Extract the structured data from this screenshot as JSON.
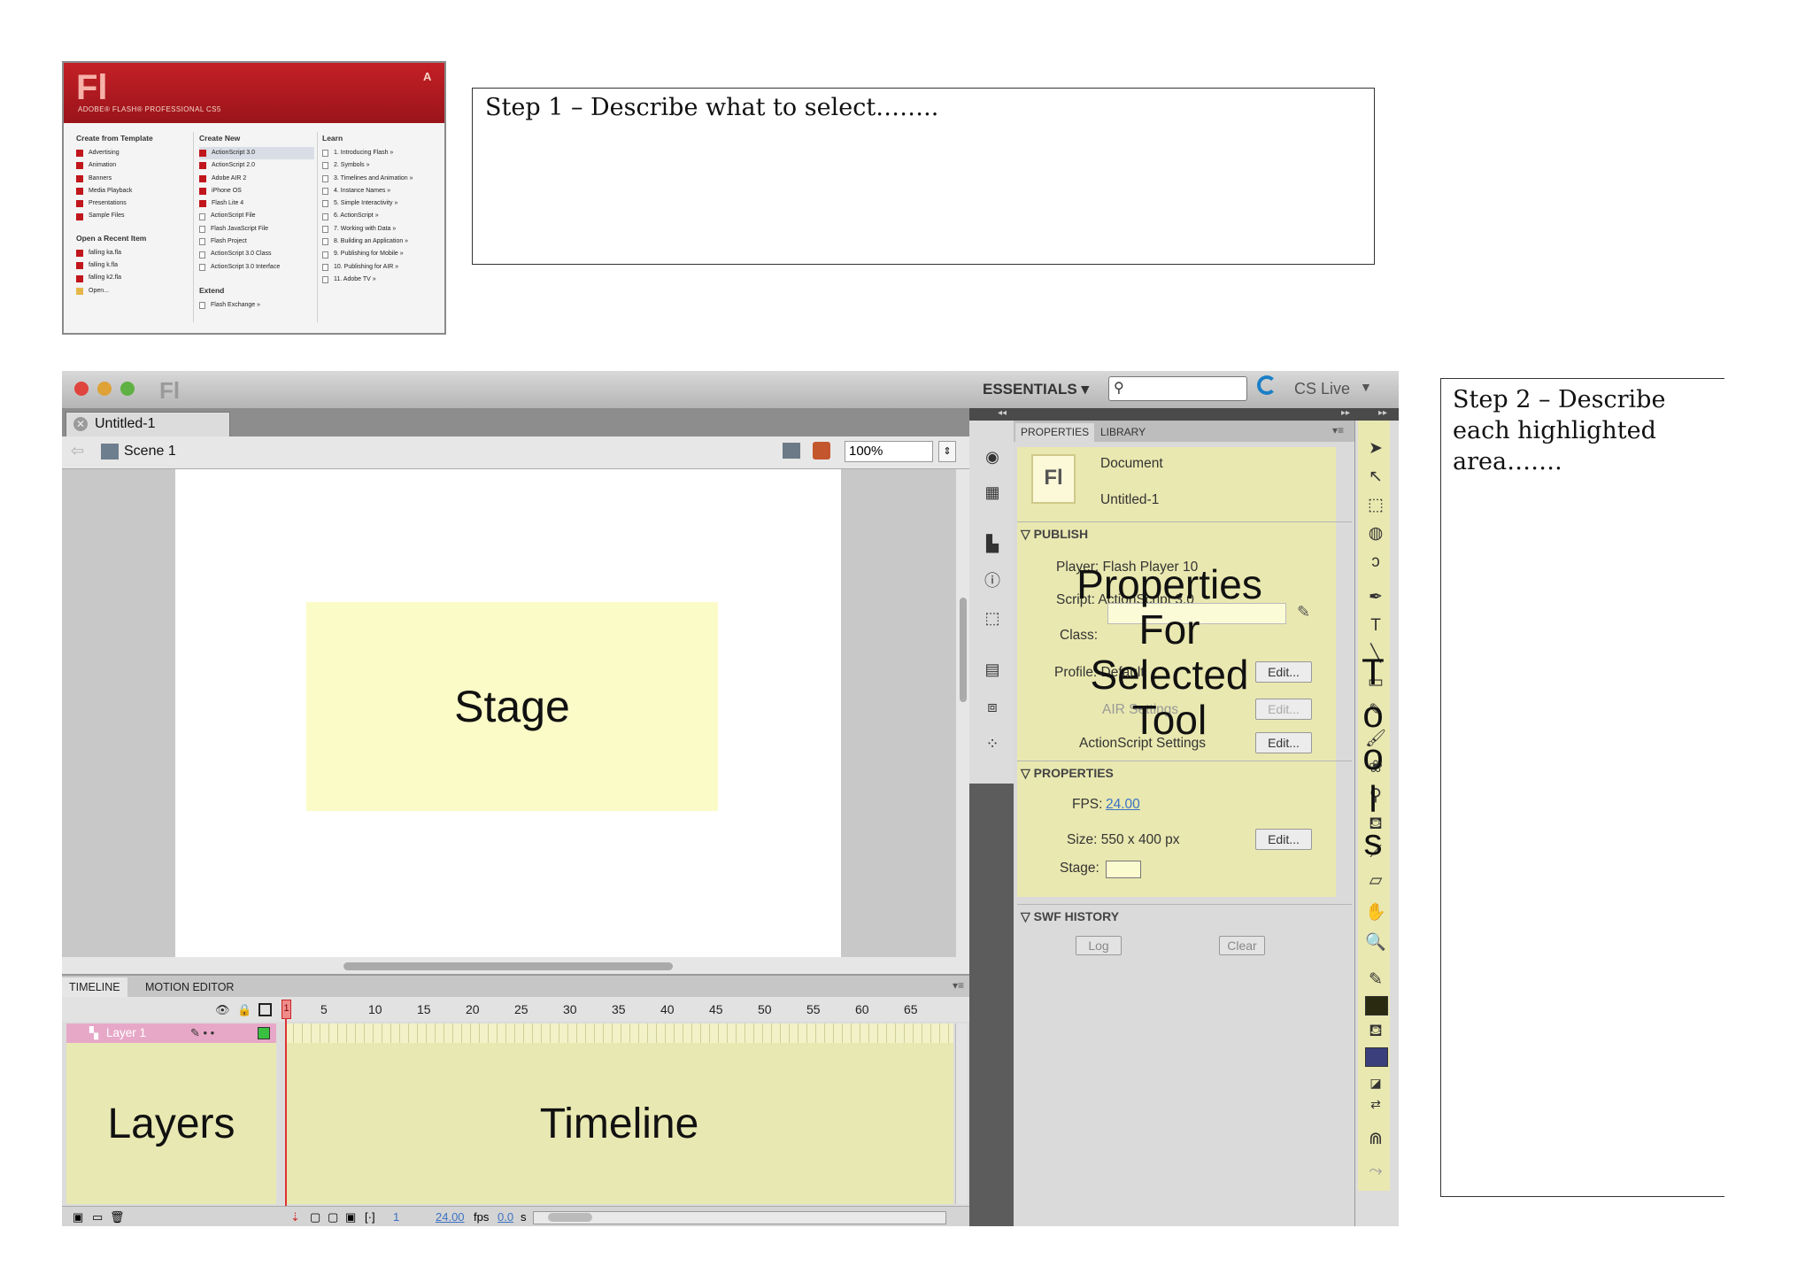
{
  "welcome": {
    "logo": "Fl",
    "product": "ADOBE® FLASH® PROFESSIONAL CS5",
    "adobe_mark": "A",
    "template_heading": "Create from Template",
    "templates": [
      "Advertising",
      "Animation",
      "Banners",
      "Media Playback",
      "Presentations",
      "Sample Files"
    ],
    "recent_heading": "Open a Recent Item",
    "recent": [
      "falling ka.fla",
      "falling k.fla",
      "falling k2.fla",
      "Open..."
    ],
    "new_heading": "Create New",
    "new_items": [
      "ActionScript 3.0",
      "ActionScript 2.0",
      "Adobe AIR 2",
      "iPhone OS",
      "Flash Lite 4",
      "ActionScript File",
      "Flash JavaScript File",
      "Flash Project",
      "ActionScript 3.0 Class",
      "ActionScript 3.0 Interface"
    ],
    "extend_heading": "Extend",
    "extend_item": "Flash Exchange »",
    "learn_heading": "Learn",
    "learn_items": [
      "1. Introducing Flash »",
      "2. Symbols »",
      "3. Timelines and Animation »",
      "4. Instance Names »",
      "5. Simple Interactivity »",
      "6. ActionScript »",
      "7. Working with Data »",
      "8. Building an Application »",
      "9. Publishing for Mobile »",
      "10. Publishing for AIR »",
      "11. Adobe TV »"
    ]
  },
  "step1": "Step 1 – Describe what to select……..",
  "step2": "Step 2 – Describe each highlighted area…….",
  "ide": {
    "app_mark": "Fl",
    "workspace": "ESSENTIALS ▾",
    "search_icon": "magnifier-icon",
    "cs_live": "CS Live",
    "doc_tab": "Untitled-1",
    "scene": "Scene 1",
    "zoom": "100%",
    "stage_label": "Stage",
    "timeline": {
      "tabs": [
        "TIMELINE",
        "MOTION EDITOR"
      ],
      "frame_numbers": [
        "5",
        "10",
        "15",
        "20",
        "25",
        "30",
        "35",
        "40",
        "45",
        "50",
        "55",
        "60",
        "65"
      ],
      "current_frame": "1",
      "layer_name": "Layer 1",
      "layers_label": "Layers",
      "timeline_label": "Timeline",
      "frame_value": "1",
      "fps": "24.00",
      "fps_unit": "fps",
      "time": "0.0",
      "time_unit": "s"
    },
    "properties": {
      "tabs": [
        "PROPERTIES",
        "LIBRARY"
      ],
      "doc_icon": "Fl",
      "doc_type": "Document",
      "doc_name": "Untitled-1",
      "publish_heading": "PUBLISH",
      "player": "Player:  Flash Player 10",
      "script": "Script:  ActionScript 3.0",
      "class_label": "Class:",
      "profile": "Profile:  Default",
      "air_settings": "AIR Settings",
      "as_settings": "ActionScript Settings",
      "edit": "Edit...",
      "properties_heading": "PROPERTIES",
      "fps_label": "FPS:",
      "fps_value": "24.00",
      "size": "Size:  550 x 400 px",
      "stage_label": "Stage:",
      "swf_heading": "SWF HISTORY",
      "log": "Log",
      "clear": "Clear",
      "overlay": [
        "Properties",
        "For",
        "Selected",
        "Tool"
      ]
    },
    "tools_overlay": [
      "T",
      "o",
      "o",
      "l",
      "s"
    ],
    "colors": {
      "highlight": "#e9e8b0",
      "stage_highlight": "#fbfbc8",
      "layer_row": "#e7a8c8"
    }
  }
}
